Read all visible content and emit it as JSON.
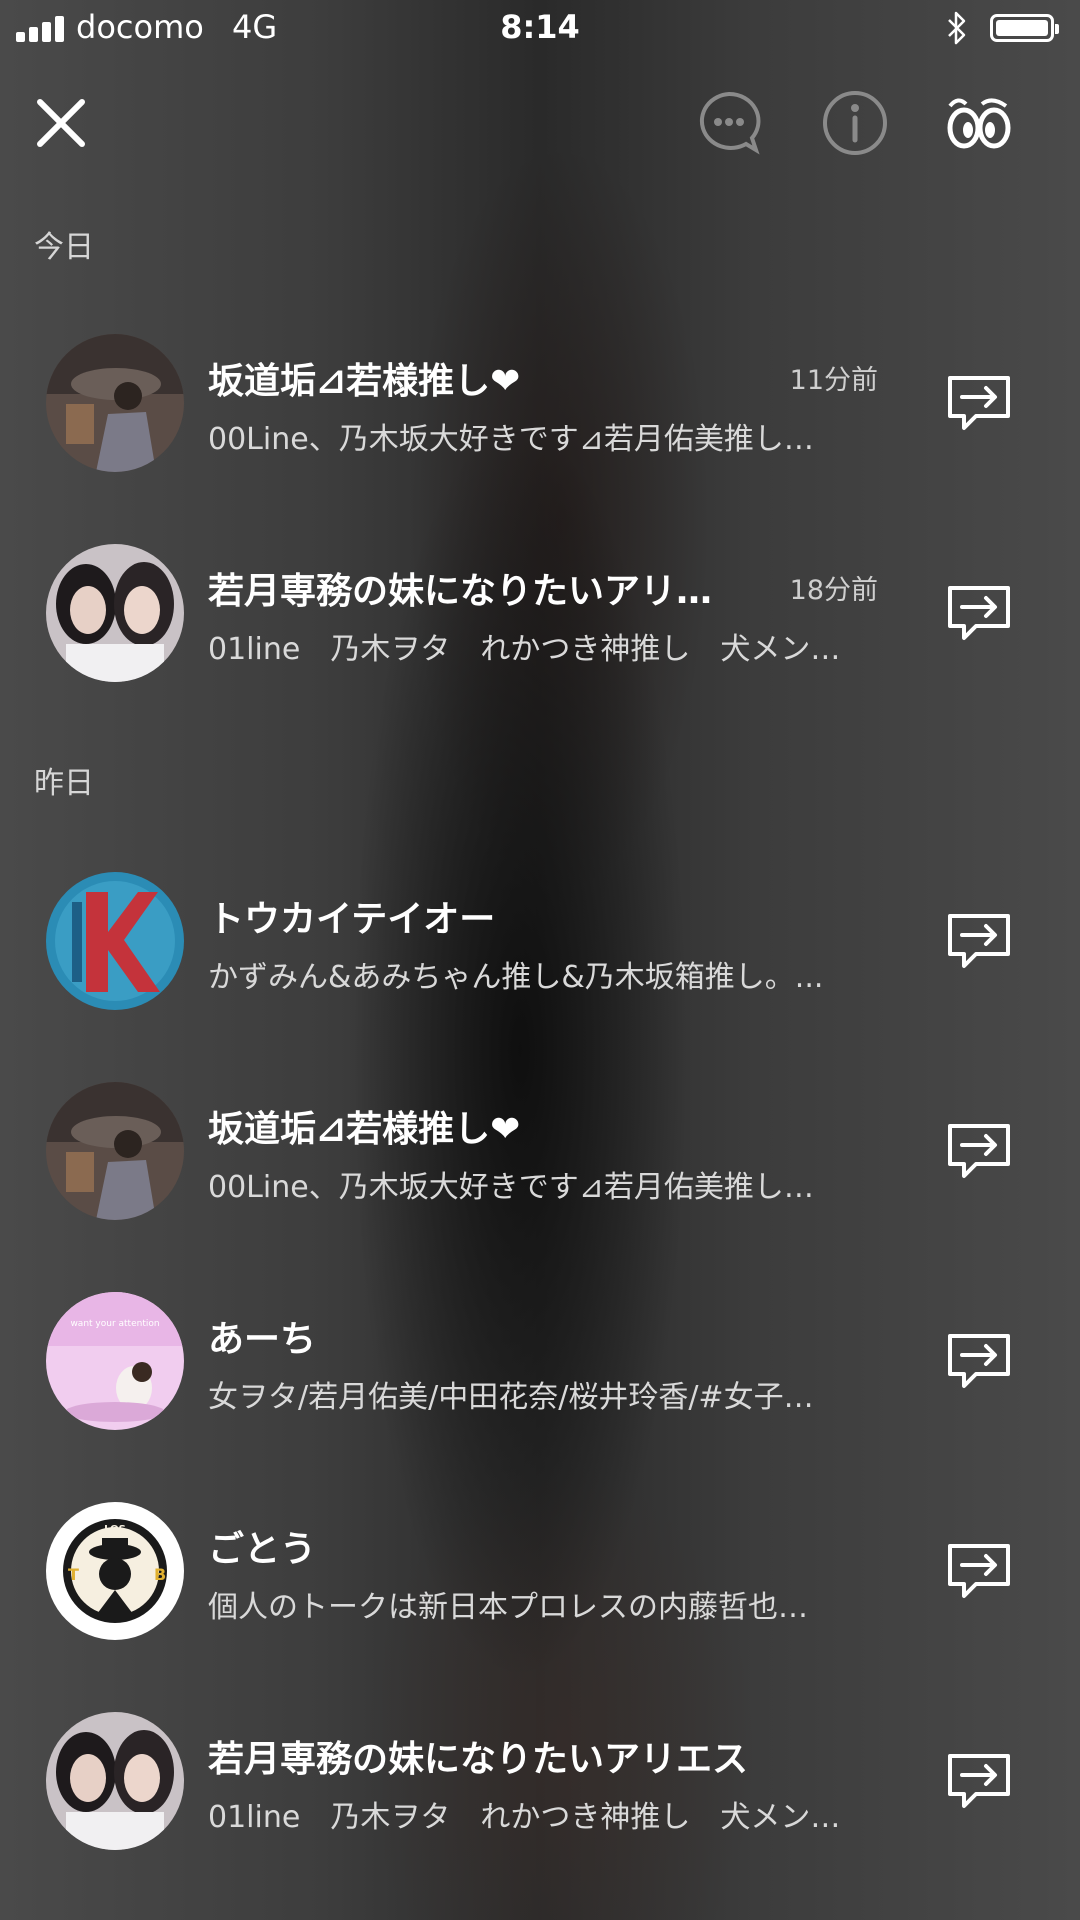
{
  "status_bar": {
    "carrier": "docomo",
    "network": "4G",
    "time": "8:14"
  },
  "header": {
    "close_icon": "close-icon",
    "chat_icon": "chat-bubble-icon",
    "info_icon": "info-icon",
    "app_icon": "eyes-icon"
  },
  "sections": [
    {
      "label": "今日",
      "items": [
        {
          "title": "坂道垢⊿若様推し❤",
          "time": "11分前",
          "subtitle": "00Line、乃木坂大好きです⊿若月佑美推し…"
        },
        {
          "title": "若月専務の妹になりたいアリ…",
          "time": "18分前",
          "subtitle": "01line　乃木ヲタ　れかつき神推し　犬メン…"
        }
      ]
    },
    {
      "label": "昨日",
      "items": [
        {
          "title": "トウカイテイオー",
          "time": "",
          "subtitle": "かずみん&あみちゃん推し&乃木坂箱推し。..."
        },
        {
          "title": "坂道垢⊿若様推し❤",
          "time": "",
          "subtitle": "00Line、乃木坂大好きです⊿若月佑美推し…"
        },
        {
          "title": "あーち",
          "time": "",
          "subtitle": "女ヲタ/若月佑美/中田花奈/桜井玲香/#女子…"
        },
        {
          "title": "ごとう",
          "time": "",
          "subtitle": "個人のトークは新日本プロレスの内藤哲也…"
        },
        {
          "title": "若月専務の妹になりたいアリエス",
          "time": "",
          "subtitle": "01line　乃木ヲタ　れかつき神推し　犬メン…"
        }
      ]
    }
  ]
}
